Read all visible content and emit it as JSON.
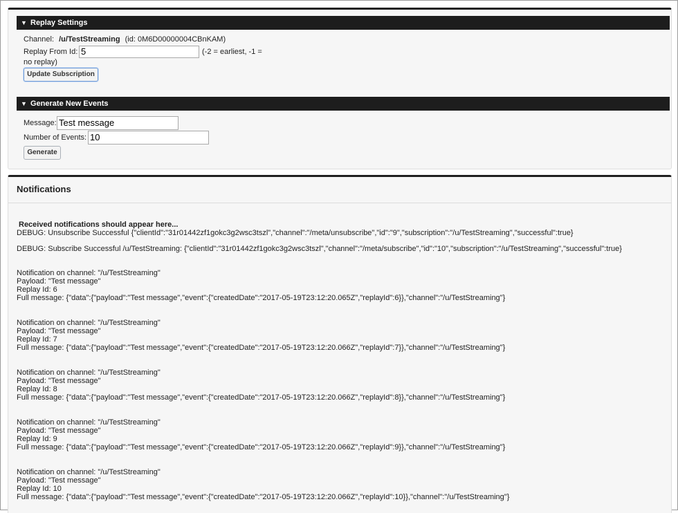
{
  "replay": {
    "header": "Replay Settings",
    "channel_label": "Channel:",
    "channel_name": "/u/TestStreaming",
    "channel_id": "(id:  0M6D00000004CBnKAM)",
    "replay_from_label": "Replay From Id:",
    "replay_from_value": "5",
    "hint_line1": "(-2 = earliest, -1 =",
    "hint_line2": "no replay)",
    "update_button": "Update Subscription"
  },
  "generate": {
    "header": "Generate New Events",
    "message_label": "Message:",
    "message_value": "Test message",
    "count_label": "Number of Events:",
    "count_value": "10",
    "generate_button": "Generate"
  },
  "notifications": {
    "title": "Notifications",
    "intro": "Received notifications should appear here...",
    "debug": [
      "DEBUG: Unsubscribe Successful {\"clientId\":\"31r01442zf1gokc3g2wsc3tszl\",\"channel\":\"/meta/unsubscribe\",\"id\":\"9\",\"subscription\":\"/u/TestStreaming\",\"successful\":true}",
      "DEBUG: Subscribe Successful /u/TestStreaming: {\"clientId\":\"31r01442zf1gokc3g2wsc3tszl\",\"channel\":\"/meta/subscribe\",\"id\":\"10\",\"subscription\":\"/u/TestStreaming\",\"successful\":true}"
    ],
    "items": [
      {
        "channel": "Notification on channel: \"/u/TestStreaming\"",
        "payload": "Payload: \"Test message\"",
        "replay": "Replay Id: 6",
        "full": "Full message: {\"data\":{\"payload\":\"Test message\",\"event\":{\"createdDate\":\"2017-05-19T23:12:20.065Z\",\"replayId\":6}},\"channel\":\"/u/TestStreaming\"}"
      },
      {
        "channel": "Notification on channel: \"/u/TestStreaming\"",
        "payload": "Payload: \"Test message\"",
        "replay": "Replay Id: 7",
        "full": "Full message: {\"data\":{\"payload\":\"Test message\",\"event\":{\"createdDate\":\"2017-05-19T23:12:20.066Z\",\"replayId\":7}},\"channel\":\"/u/TestStreaming\"}"
      },
      {
        "channel": "Notification on channel: \"/u/TestStreaming\"",
        "payload": "Payload: \"Test message\"",
        "replay": "Replay Id: 8",
        "full": "Full message: {\"data\":{\"payload\":\"Test message\",\"event\":{\"createdDate\":\"2017-05-19T23:12:20.066Z\",\"replayId\":8}},\"channel\":\"/u/TestStreaming\"}"
      },
      {
        "channel": "Notification on channel: \"/u/TestStreaming\"",
        "payload": "Payload: \"Test message\"",
        "replay": "Replay Id: 9",
        "full": "Full message: {\"data\":{\"payload\":\"Test message\",\"event\":{\"createdDate\":\"2017-05-19T23:12:20.066Z\",\"replayId\":9}},\"channel\":\"/u/TestStreaming\"}"
      },
      {
        "channel": "Notification on channel: \"/u/TestStreaming\"",
        "payload": "Payload: \"Test message\"",
        "replay": "Replay Id: 10",
        "full": "Full message: {\"data\":{\"payload\":\"Test message\",\"event\":{\"createdDate\":\"2017-05-19T23:12:20.066Z\",\"replayId\":10}},\"channel\":\"/u/TestStreaming\"}"
      }
    ]
  }
}
